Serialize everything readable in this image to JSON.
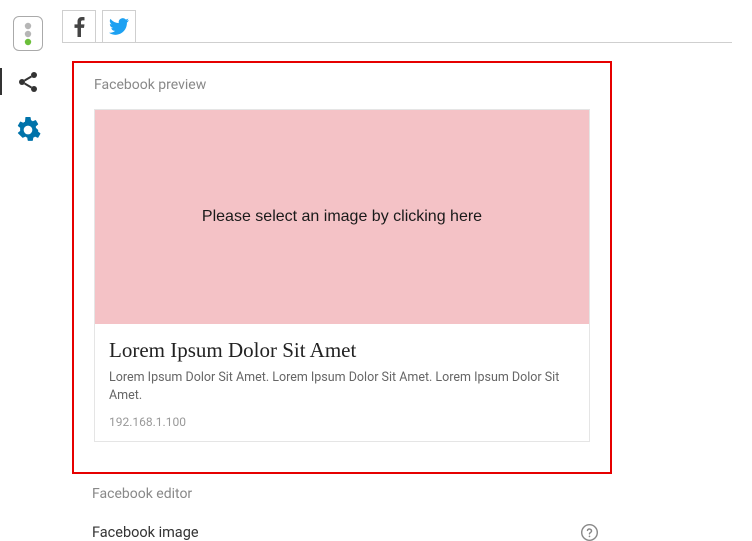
{
  "sidebar": {
    "items": [
      {
        "name": "traffic-light-icon"
      },
      {
        "name": "share-icon"
      },
      {
        "name": "gear-icon"
      }
    ]
  },
  "tabs": {
    "facebook": {
      "name": "facebook-tab"
    },
    "twitter": {
      "name": "twitter-tab"
    }
  },
  "preview": {
    "section_title": "Facebook preview",
    "image_placeholder": "Please select an image by clicking here",
    "card": {
      "title": "Lorem Ipsum Dolor Sit Amet",
      "description": "Lorem Ipsum Dolor Sit Amet. Lorem Ipsum Dolor Sit Amet. Lorem Ipsum Dolor Sit Amet.",
      "domain": "192.168.1.100"
    }
  },
  "editor": {
    "section_title": "Facebook editor",
    "image_label": "Facebook image"
  }
}
